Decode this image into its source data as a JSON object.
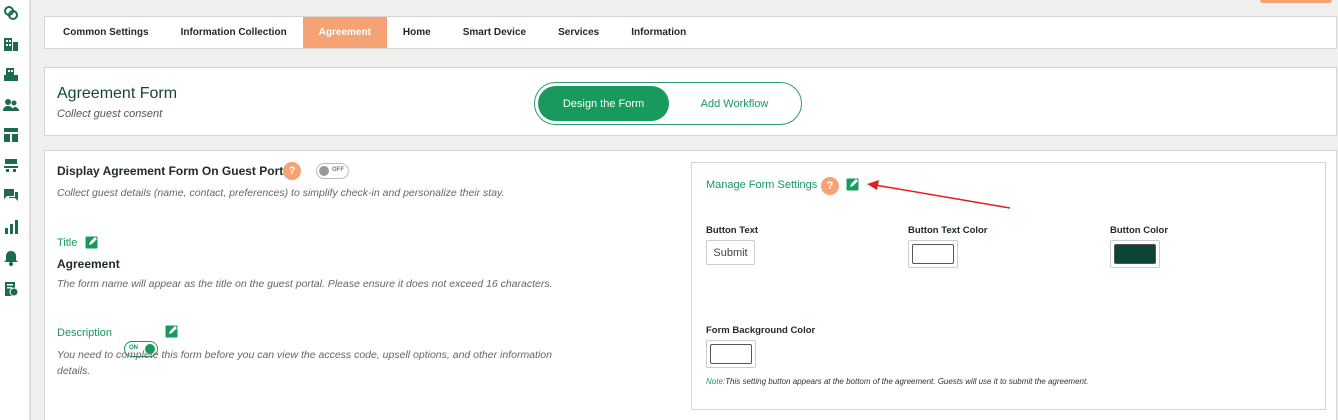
{
  "tabs": [
    {
      "label": "Common Settings"
    },
    {
      "label": "Information Collection"
    },
    {
      "label": "Agreement"
    },
    {
      "label": "Home"
    },
    {
      "label": "Smart Device"
    },
    {
      "label": "Services"
    },
    {
      "label": "Information"
    }
  ],
  "active_tab": "Agreement",
  "header": {
    "title": "Agreement Form",
    "subtitle": "Collect guest consent",
    "segment_design": "Design the Form",
    "segment_workflow": "Add Workflow"
  },
  "display": {
    "title": "Display Agreement Form On Guest Portal",
    "help": "?",
    "toggle_text": "OFF",
    "note": "Collect guest details (name, contact, preferences) to simplify check-in and personalize their stay."
  },
  "title_field": {
    "label": "Title",
    "value": "Agreement",
    "note": "The form name will appear as the title on the guest portal. Please ensure it does not exceed 16 characters."
  },
  "description_field": {
    "label": "Description",
    "toggle_text": "ON",
    "note": "You need to complete this form before you can view the access code, upsell options, and other information details."
  },
  "form_settings": {
    "title": "Manage Form Settings",
    "help": "?",
    "button_text_label": "Button Text",
    "button_text_value": "Submit",
    "button_text_color_label": "Button Text Color",
    "button_text_color": "#ffffff",
    "button_color_label": "Button Color",
    "button_color": "#0e4437",
    "form_bg_color_label": "Form Background Color",
    "form_bg_color": "#ffffff",
    "note_prefix": "Note:",
    "note_text": "This setting button appears at the bottom of the agreement. Guests will use it to submit the agreement."
  },
  "colors": {
    "accent_green": "#179a5c",
    "accent_orange": "#f5a274",
    "annotation_arrow": "#e02020"
  }
}
